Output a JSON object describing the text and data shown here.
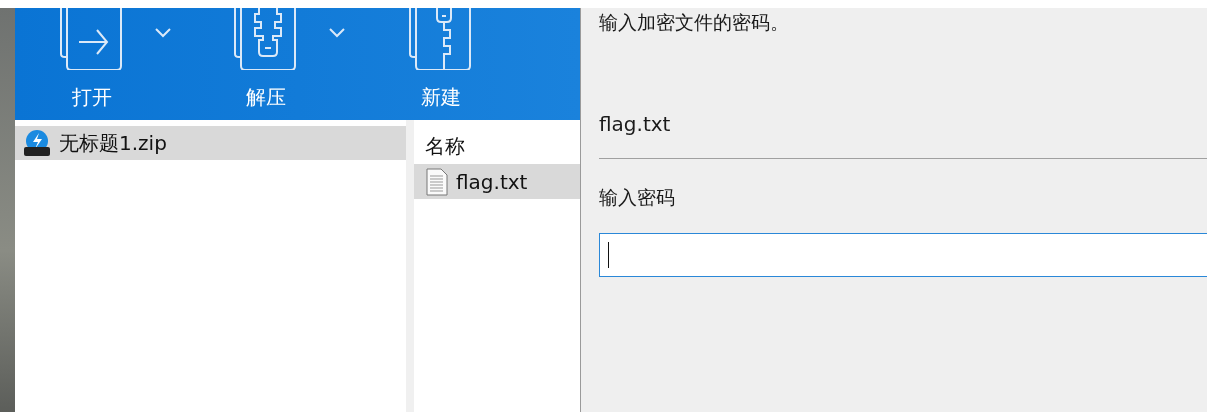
{
  "toolbar": [
    {
      "label": "打开",
      "kind": "open",
      "dropdown": true
    },
    {
      "label": "解压",
      "kind": "extract",
      "dropdown": true
    },
    {
      "label": "新建",
      "kind": "new",
      "dropdown": false
    }
  ],
  "folder_tree": {
    "items": [
      {
        "label": "无标题1.zip",
        "selected": true
      }
    ]
  },
  "file_list": {
    "columns": [
      "名称"
    ],
    "rows": [
      {
        "name": "flag.txt",
        "selected": true
      }
    ]
  },
  "password_dialog": {
    "prompt": "输入加密文件的密码。",
    "file_name": "flag.txt",
    "field_label": "输入密码",
    "password_field": {
      "focused": true
    }
  }
}
